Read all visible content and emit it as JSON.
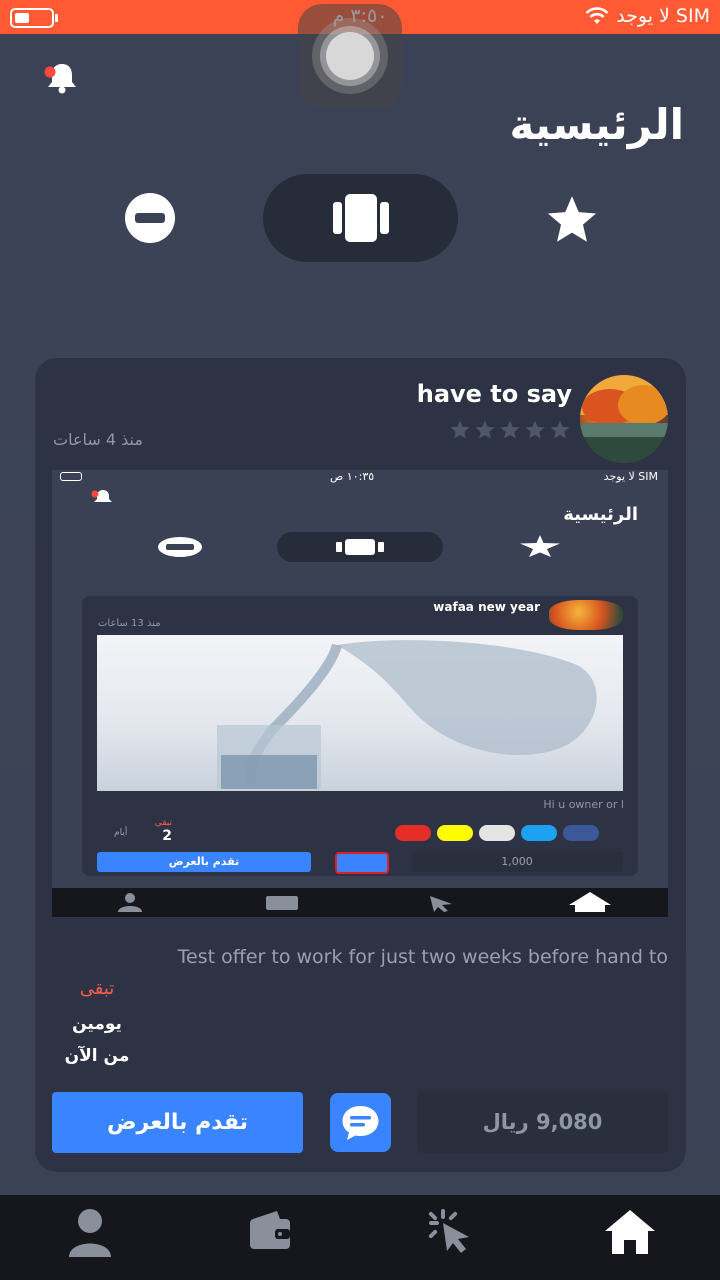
{
  "status_bar": {
    "time": "٣:٥٠ م",
    "carrier": "لا يوجد SIM"
  },
  "header": {
    "title": "الرئيسية"
  },
  "view_controls": {
    "icons": [
      "minus-circle-icon",
      "cards-view-icon",
      "star-icon"
    ]
  },
  "post": {
    "title": "have to say",
    "time_ago": "منذ 4 ساعات",
    "rating": 0,
    "rating_max": 5,
    "description": "Test offer to work for just two weeks before hand to",
    "remaining_label": "تبقى",
    "remaining_value": "يومين",
    "remaining_since": "من الآن",
    "apply_label": "تقدم بالعرض",
    "price": "9,080 ريال"
  },
  "embedded_screenshot": {
    "status_time": "١٠:٣٥ ص",
    "status_carrier": "لا يوجد SIM",
    "title": "الرئيسية",
    "post_title": "wafaa new year",
    "post_time": "منذ 13 ساعات",
    "text": "Hi u owner or l",
    "remaining_label": "تبقى",
    "remaining_value": "2",
    "remaining_unit": "أيام",
    "apply_label": "تقدم بالعرض",
    "price": "1,000",
    "social_colors": [
      "#e52d27",
      "#fffc00",
      "#e4e4e4",
      "#1da1f2",
      "#3b5998"
    ]
  },
  "bottom_nav": {
    "items": [
      "profile-icon",
      "wallet-icon",
      "click-icon",
      "home-icon"
    ],
    "active": "home-icon"
  },
  "colors": {
    "status_bar": "#ff5a33",
    "accent": "#3a84ff",
    "card_bg": "#2d3344",
    "page_bg": "#3b4256",
    "nav_bg": "#15171d",
    "remaining": "#ff5a4f"
  }
}
